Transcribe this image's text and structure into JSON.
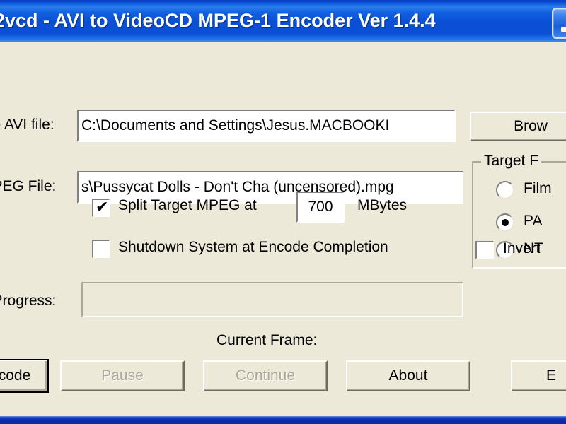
{
  "window": {
    "title": "2vcd - AVI to VideoCD MPEG-1 Encoder Ver 1.4.4",
    "minimize_label": "minimize",
    "titlebar_color": "#0A4FD4",
    "client_color": "#ECE9D8"
  },
  "source": {
    "label": "rce AVI file:",
    "value": "C:\\Documents and Settings\\Jesus.MACBOOKI",
    "browse_label": "Brow"
  },
  "target": {
    "label": "MPEG File:",
    "value": "s\\Pussycat Dolls - Don't Cha (uncensored).mpg"
  },
  "format_group": {
    "title": "Target F",
    "options": [
      {
        "label": "Film",
        "selected": false
      },
      {
        "label": "PA",
        "selected": true
      },
      {
        "label": "NT",
        "selected": false
      }
    ]
  },
  "split": {
    "checked": true,
    "label_before": "Split Target MPEG at",
    "size_value": "700",
    "units_label": "MBytes"
  },
  "shutdown": {
    "checked": false,
    "label": "Shutdown System at Encode Completion"
  },
  "invert": {
    "checked": false,
    "label": "Invert"
  },
  "progress": {
    "label": "e Progress:",
    "value": ""
  },
  "current_frame": {
    "label": "Current Frame:",
    "value": ""
  },
  "buttons": {
    "encode": {
      "label": "code",
      "enabled": true,
      "focused": true
    },
    "pause": {
      "label": "Pause",
      "enabled": false
    },
    "continue": {
      "label": "Continue",
      "enabled": false
    },
    "about": {
      "label": "About",
      "enabled": true
    },
    "exit": {
      "label": "E",
      "enabled": true
    }
  }
}
